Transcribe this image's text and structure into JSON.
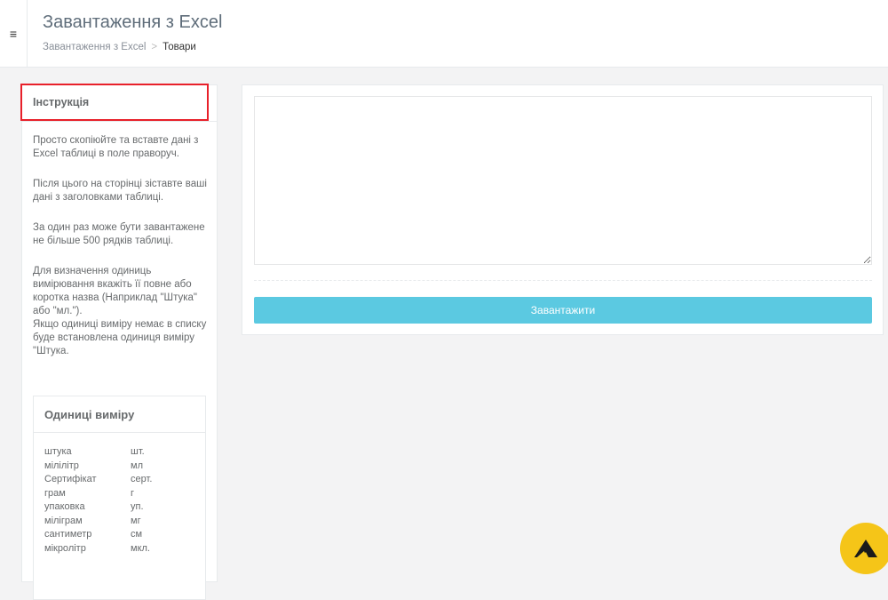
{
  "header": {
    "menu_icon": "hamburger-icon",
    "menu_glyph": "≡",
    "title": "Завантаження з Excel",
    "breadcrumb": {
      "parent": "Завантаження з Excel",
      "separator": ">",
      "current": "Товари"
    }
  },
  "instructions": {
    "title": "Інструкція",
    "paragraphs": [
      "Просто скопіюйте та вставте дані з Excel таблиці в поле праворуч.",
      "Після цього на сторінці зіставте ваші дані з заголовками таблиці.",
      "За один раз може бути завантажене не більше 500 рядків таблиці.",
      "Для визначення одиниць вимірювання вкажіть її повне або коротка назва (Наприклад \"Штука\" або \"мл.\").",
      "Якщо одиниці виміру немає в списку буде встановлена одиниця виміру \"Штука."
    ]
  },
  "units": {
    "title": "Одиниці виміру",
    "items": [
      {
        "name": "штука",
        "short": "шт."
      },
      {
        "name": "мілілітр",
        "short": "мл"
      },
      {
        "name": "Сертифікат",
        "short": "серт."
      },
      {
        "name": "грам",
        "short": "г"
      },
      {
        "name": "упаковка",
        "short": "уп."
      },
      {
        "name": "міліграм",
        "short": "мг"
      },
      {
        "name": "сантиметр",
        "short": "см"
      },
      {
        "name": "мікролітр",
        "short": "мкл."
      }
    ]
  },
  "import_form": {
    "textarea_value": "",
    "upload_button": "Завантажити"
  },
  "colors": {
    "accent_button": "#5bc9e1",
    "highlight_border": "#e8202a",
    "fab_background": "#f5c518"
  },
  "fab": {
    "icon": "brand-logo-icon"
  }
}
